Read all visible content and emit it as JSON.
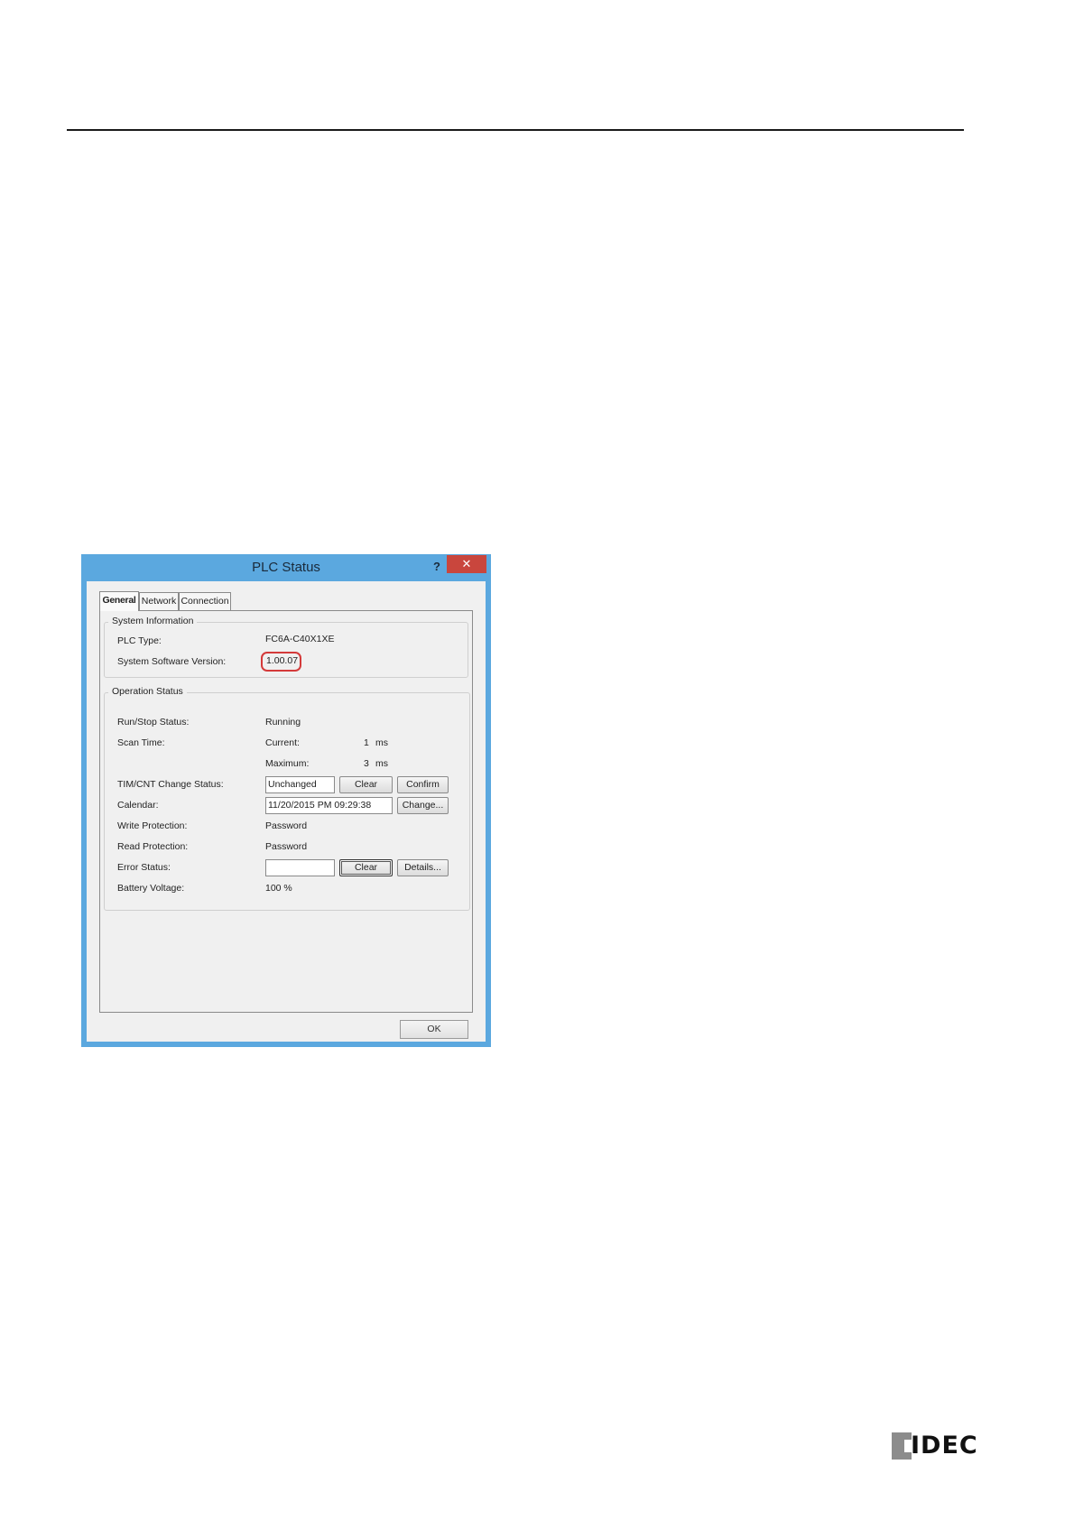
{
  "dialog": {
    "title": "PLC Status",
    "help_label": "?",
    "close_label": "✕",
    "tabs": [
      "General",
      "Network",
      "Connection"
    ],
    "system_info": {
      "title": "System Information",
      "plc_type_label": "PLC Type:",
      "plc_type_value": "FC6A-C40X1XE",
      "version_label": "System Software Version:",
      "version_value": "1.00.07"
    },
    "operation": {
      "title": "Operation Status",
      "run_stop_label": "Run/Stop Status:",
      "run_stop_value": "Running",
      "scan_time_label": "Scan Time:",
      "current_label": "Current:",
      "current_value": "1",
      "current_unit": "ms",
      "maximum_label": "Maximum:",
      "maximum_value": "3",
      "maximum_unit": "ms",
      "timcnt_label": "TIM/CNT Change Status:",
      "timcnt_value": "Unchanged",
      "clear_label": "Clear",
      "confirm_label": "Confirm",
      "calendar_label": "Calendar:",
      "calendar_value": "11/20/2015 PM 09:29:38",
      "change_label": "Change...",
      "write_protection_label": "Write Protection:",
      "write_protection_value": "Password",
      "read_protection_label": "Read Protection:",
      "read_protection_value": "Password",
      "error_status_label": "Error Status:",
      "error_status_value": "",
      "error_clear_label": "Clear",
      "details_label": "Details...",
      "battery_label": "Battery Voltage:",
      "battery_value": "100 %"
    },
    "ok_label": "OK"
  },
  "logo": {
    "text": "IDEC"
  }
}
